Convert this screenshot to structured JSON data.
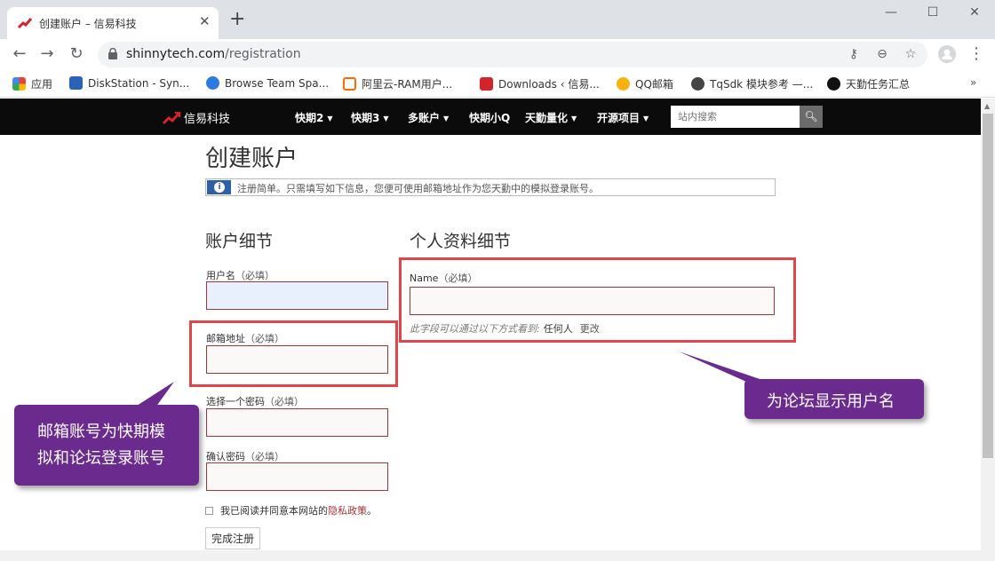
{
  "browser": {
    "tab_title": "创建账户 – 信易科技",
    "url_domain": "shinnytech.com",
    "url_path": "/registration",
    "bookmarks": [
      {
        "label": "应用",
        "icon": "apps-grid-icon",
        "color": "#4285f4"
      },
      {
        "label": "DiskStation - Syn...",
        "icon": "dsm-icon",
        "color": "#2a62b8"
      },
      {
        "label": "Browse Team Spa...",
        "icon": "atlassian-icon",
        "color": "#2d7be0"
      },
      {
        "label": "阿里云-RAM用户...",
        "icon": "aliyun-icon",
        "color": "#ff6a00"
      },
      {
        "label": "Downloads ‹ 信易...",
        "icon": "shinny-logo-icon",
        "color": "#d4232b"
      },
      {
        "label": "QQ邮箱",
        "icon": "qqmail-icon",
        "color": "#f6b20e"
      },
      {
        "label": "TqSdk 模块参考 —...",
        "icon": "readthedocs-icon",
        "color": "#444444"
      },
      {
        "label": "天勤任务汇总",
        "icon": "github-icon",
        "color": "#111111"
      }
    ]
  },
  "site": {
    "logo_text": "信易科技",
    "menu": [
      {
        "label": "快期2",
        "dropdown": true
      },
      {
        "label": "快期3",
        "dropdown": true
      },
      {
        "label": "多账户",
        "dropdown": true
      },
      {
        "label": "快期小Q",
        "dropdown": false
      },
      {
        "label": "天勤量化",
        "dropdown": true
      },
      {
        "label": "开源项目",
        "dropdown": true
      }
    ],
    "search_placeholder": "站内搜索"
  },
  "page": {
    "title": "创建账户",
    "notice": "注册简单。只需填写如下信息，您便可使用邮箱地址作为您天勤中的模拟登录账号。",
    "account_section": "账户细节",
    "profile_section": "个人资料细节",
    "required": "（必填）",
    "fields": {
      "username": "用户名",
      "email": "邮箱地址",
      "password": "选择一个密码",
      "confirm": "确认密码",
      "name": "Name"
    },
    "visibility_prefix": "此字段可以通过以下方式看到:",
    "visibility_value": "任何人",
    "visibility_change": "更改",
    "agree_text": "我已阅读并同意本网站的",
    "privacy_link": "隐私政策",
    "agree_end": "。",
    "submit": "完成注册"
  },
  "annotations": {
    "left_callout_line1": "邮箱账号为快期模",
    "left_callout_line2": "拟和论坛登录账号",
    "right_callout": "为论坛显示用户名",
    "callout_color": "#6a2a8e",
    "highlight_color": "#e0454c"
  }
}
